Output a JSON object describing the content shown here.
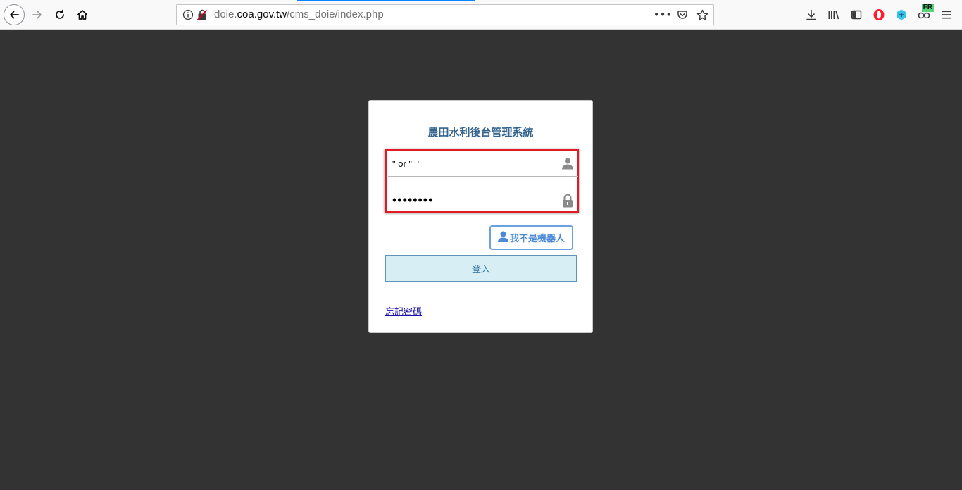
{
  "browser": {
    "url_prefix": "doie.",
    "url_host": "coa.gov.tw",
    "url_path": "/cms_doie/index.php",
    "translate_badge": "FR",
    "accent_color": "#0a84ff"
  },
  "login": {
    "title": "農田水利後台管理系統",
    "username_value": "\" or \"='",
    "password_value": "12345678",
    "robot_label": "我不是機器人",
    "login_label": "登入",
    "forgot_label": "忘記密碼",
    "highlight_color": "#e01b24",
    "title_color": "#34648e"
  },
  "icons": {
    "username": "user-icon",
    "password": "lock-icon",
    "robot": "user-icon"
  }
}
